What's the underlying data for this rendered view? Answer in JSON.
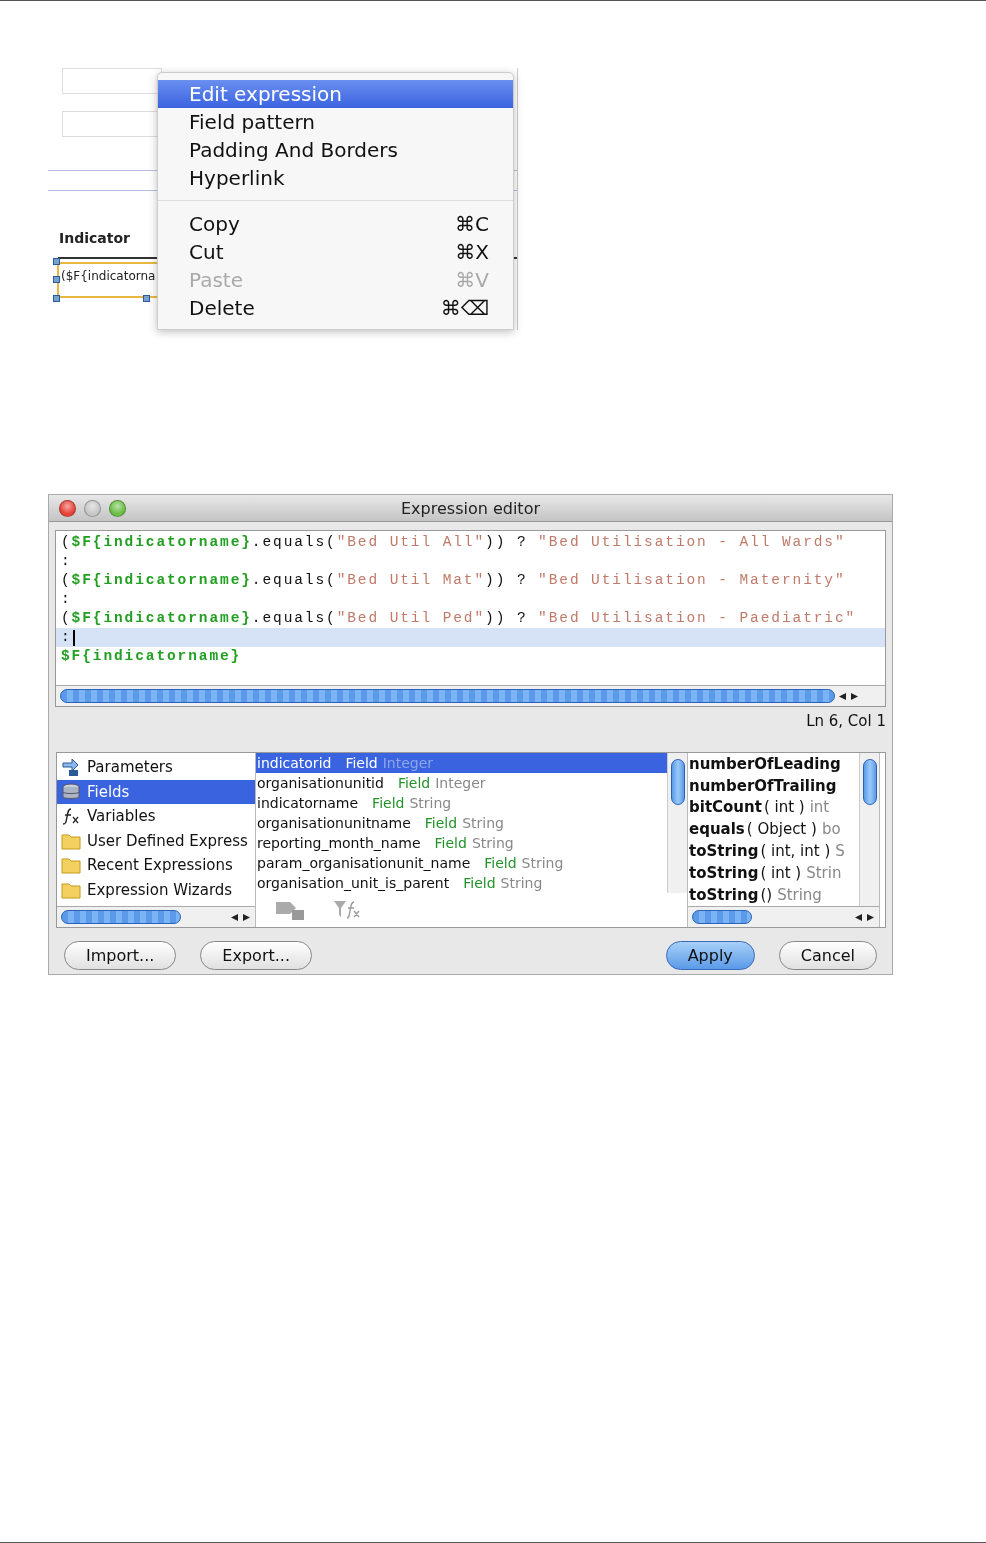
{
  "canvas": {
    "header": "Indicator",
    "cell": "($F{indicatorna"
  },
  "context_menu": {
    "groups": [
      [
        {
          "label": "Edit expression",
          "selected": true,
          "disabled": false
        },
        {
          "label": "Field pattern",
          "selected": false,
          "disabled": false
        },
        {
          "label": "Padding And Borders",
          "selected": false,
          "disabled": false
        },
        {
          "label": "Hyperlink",
          "selected": false,
          "disabled": false
        }
      ],
      [
        {
          "label": "Copy",
          "shortcut": "⌘C",
          "selected": false,
          "disabled": false
        },
        {
          "label": "Cut",
          "shortcut": "⌘X",
          "selected": false,
          "disabled": false
        },
        {
          "label": "Paste",
          "shortcut": "⌘V",
          "selected": false,
          "disabled": true
        },
        {
          "label": "Delete",
          "shortcut": "⌘⌫",
          "selected": false,
          "disabled": false
        }
      ]
    ]
  },
  "dialog": {
    "title": "Expression editor",
    "code_lines": [
      {
        "current": false,
        "segments": [
          {
            "kind": "plain",
            "text": "("
          },
          {
            "kind": "field",
            "text": "$F{indicatorname}"
          },
          {
            "kind": "plain",
            "text": ".equals("
          },
          {
            "kind": "string",
            "text": "\"Bed Util All\""
          },
          {
            "kind": "plain",
            "text": ")) ? "
          },
          {
            "kind": "string",
            "text": "\"Bed Utilisation - All Wards\""
          }
        ]
      },
      {
        "current": false,
        "segments": [
          {
            "kind": "plain",
            "text": ":"
          }
        ]
      },
      {
        "current": false,
        "segments": [
          {
            "kind": "plain",
            "text": "("
          },
          {
            "kind": "field",
            "text": "$F{indicatorname}"
          },
          {
            "kind": "plain",
            "text": ".equals("
          },
          {
            "kind": "string",
            "text": "\"Bed Util Mat\""
          },
          {
            "kind": "plain",
            "text": ")) ? "
          },
          {
            "kind": "string",
            "text": "\"Bed Utilisation - Maternity\""
          }
        ]
      },
      {
        "current": false,
        "segments": [
          {
            "kind": "plain",
            "text": ":"
          }
        ]
      },
      {
        "current": false,
        "segments": [
          {
            "kind": "plain",
            "text": "("
          },
          {
            "kind": "field",
            "text": "$F{indicatorname}"
          },
          {
            "kind": "plain",
            "text": ".equals("
          },
          {
            "kind": "string",
            "text": "\"Bed Util Ped\""
          },
          {
            "kind": "plain",
            "text": ")) ? "
          },
          {
            "kind": "string",
            "text": "\"Bed Utilisation - Paediatric\""
          }
        ]
      },
      {
        "current": true,
        "segments": [
          {
            "kind": "plain",
            "text": ":"
          }
        ]
      },
      {
        "current": false,
        "segments": [
          {
            "kind": "field",
            "text": "$F{indicatorname}"
          }
        ]
      }
    ],
    "caret_position": "Ln 6, Col 1",
    "categories": [
      {
        "label": "Parameters",
        "kind": "parameters",
        "selected": false
      },
      {
        "label": "Fields",
        "kind": "fields",
        "selected": true
      },
      {
        "label": "Variables",
        "kind": "variables",
        "selected": false
      },
      {
        "label": "User Defined Express",
        "kind": "folder",
        "selected": false
      },
      {
        "label": "Recent Expressions",
        "kind": "folder",
        "selected": false
      },
      {
        "label": "Expression Wizards",
        "kind": "folder",
        "selected": false
      }
    ],
    "fields": [
      {
        "name": "indicatorid",
        "kind": "Field",
        "type": "Integer",
        "selected": true
      },
      {
        "name": "organisationunitid",
        "kind": "Field",
        "type": "Integer",
        "selected": false
      },
      {
        "name": "indicatorname",
        "kind": "Field",
        "type": "String",
        "selected": false
      },
      {
        "name": "organisationunitname",
        "kind": "Field",
        "type": "String",
        "selected": false
      },
      {
        "name": "reporting_month_name",
        "kind": "Field",
        "type": "String",
        "selected": false
      },
      {
        "name": "param_organisationunit_name",
        "kind": "Field",
        "type": "String",
        "selected": false
      },
      {
        "name": "organisation_unit_is_parent",
        "kind": "Field",
        "type": "String",
        "selected": false
      }
    ],
    "methods": [
      {
        "name": "numberOfLeading"
      },
      {
        "name": "numberOfTrailing"
      },
      {
        "name": "bitCount",
        "args": "( int )",
        "returns": "int"
      },
      {
        "name": "equals",
        "args": "( Object )",
        "returns": "bo"
      },
      {
        "name": "toString",
        "args": "( int, int )",
        "returns": "S"
      },
      {
        "name": "toString",
        "args": "( int )",
        "returns": "Strin"
      },
      {
        "name": "toString",
        "args": "()",
        "returns": "String"
      }
    ],
    "buttons": [
      {
        "label": "Import...",
        "default": false
      },
      {
        "label": "Export...",
        "default": false
      },
      {
        "label": "Apply",
        "default": true
      },
      {
        "label": "Cancel",
        "default": false
      }
    ]
  }
}
